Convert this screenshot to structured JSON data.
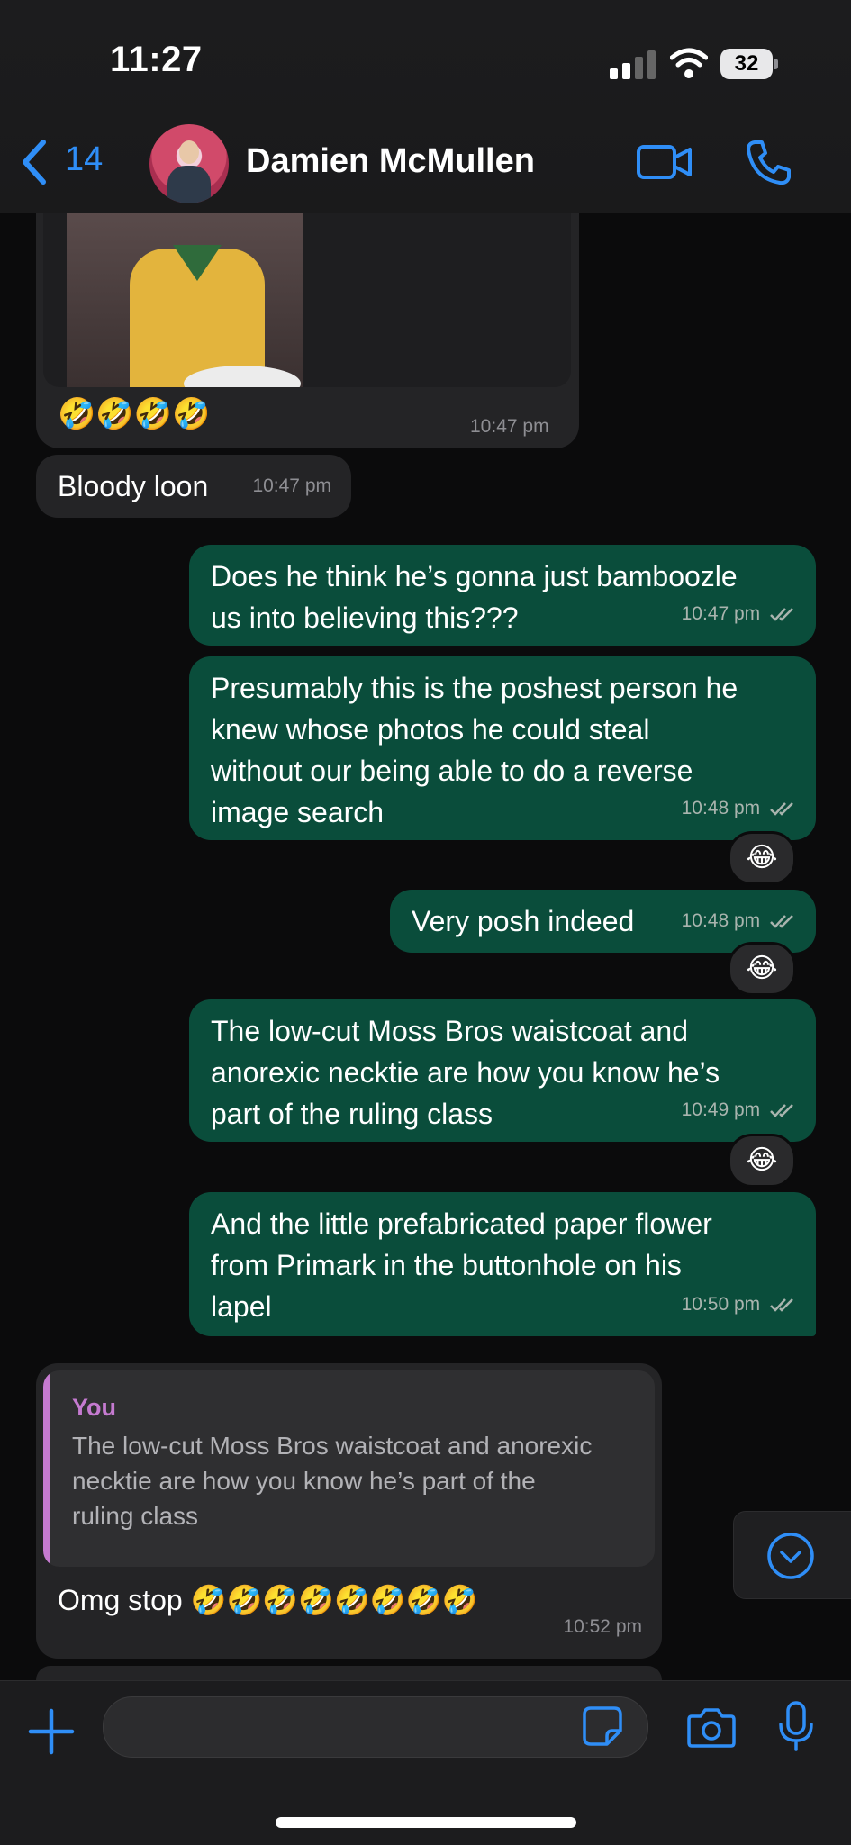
{
  "status": {
    "time": "11:27",
    "battery": "32"
  },
  "header": {
    "back_count": "14",
    "contact_name": "Damien McMullen"
  },
  "messages": [
    {
      "id": "photo",
      "reactions_text": "🤣🤣🤣🤣",
      "time": "10:47 pm"
    },
    {
      "id": "m1",
      "text": "Bloody loon",
      "time": "10:47 pm"
    },
    {
      "id": "m2",
      "lines": [
        "Does he think he’s gonna just bamboozle",
        "us into believing this???"
      ],
      "time": "10:47 pm"
    },
    {
      "id": "m3",
      "lines": [
        "Presumably this is the poshest person he",
        "knew whose photos he could steal",
        "without our being able to do a reverse",
        "image search"
      ],
      "time": "10:48 pm",
      "reaction": "😂"
    },
    {
      "id": "m4",
      "text": "Very posh indeed",
      "time": "10:48 pm",
      "reaction": "😂"
    },
    {
      "id": "m5",
      "lines": [
        "The low-cut Moss Bros waistcoat and",
        "anorexic necktie are how you know he’s",
        "part of the ruling class"
      ],
      "time": "10:49 pm",
      "reaction": "😂"
    },
    {
      "id": "m6",
      "lines": [
        "And the little prefabricated paper flower",
        "from Primark in the buttonhole on his",
        "lapel"
      ],
      "time": "10:50 pm"
    },
    {
      "id": "m7",
      "quote_author": "You",
      "quote_lines": [
        "The low-cut Moss Bros waistcoat and anorexic",
        "necktie are how you know he’s part of the",
        "ruling class"
      ],
      "text": "Omg stop 🤣🤣🤣🤣🤣🤣🤣🤣",
      "time": "10:52 pm"
    }
  ],
  "colors": {
    "accent": "#2f8ef7",
    "outgoing": "#0a4d3b",
    "incoming": "#242426",
    "quote_accent": "#c57ad0"
  }
}
